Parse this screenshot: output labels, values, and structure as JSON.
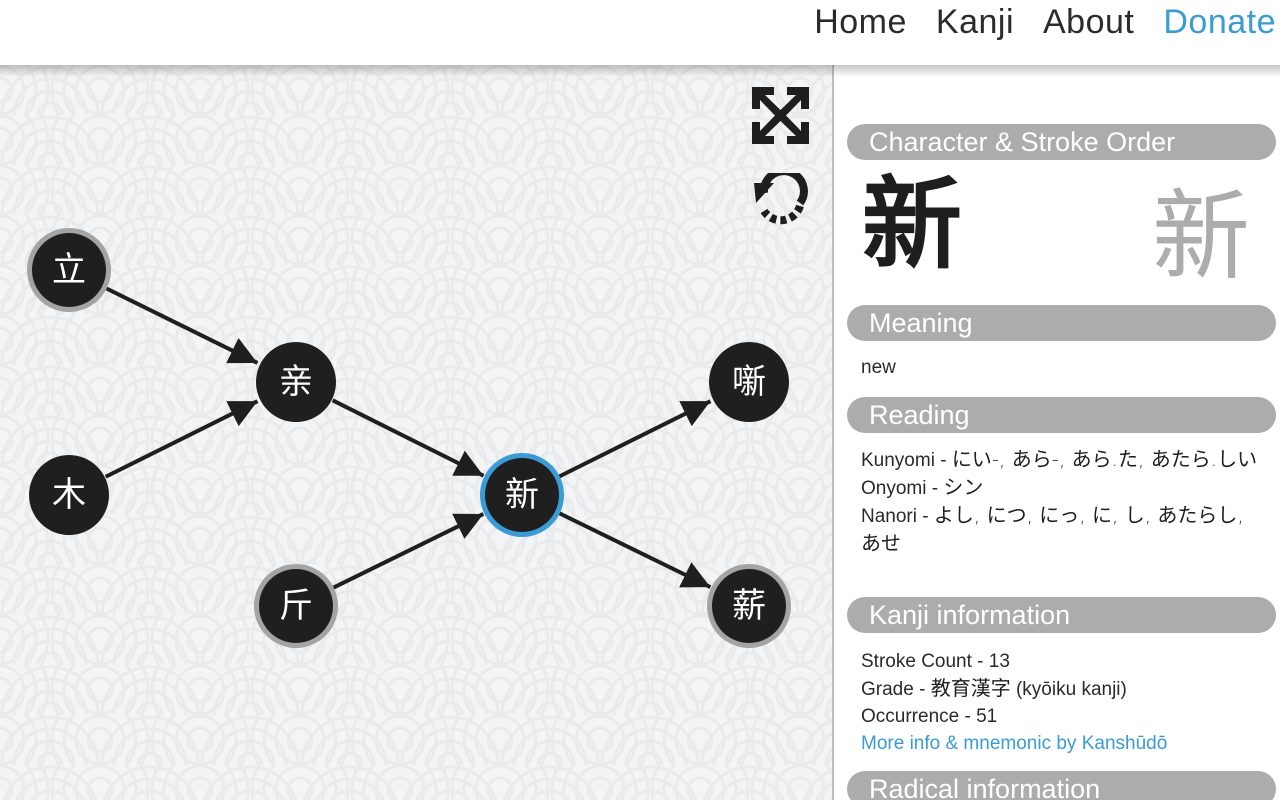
{
  "nav": {
    "items": [
      {
        "label": "Home"
      },
      {
        "label": "Kanji"
      },
      {
        "label": "About"
      },
      {
        "label": "Donate"
      }
    ],
    "accent_color": "#3a9bd5"
  },
  "graph": {
    "tools": {
      "fullscreen_icon": "expand-arrows-icon",
      "reset_icon": "rotate-reset-icon"
    },
    "nodes": [
      {
        "id": "n1",
        "char": "立",
        "ring": "gray"
      },
      {
        "id": "n2",
        "char": "亲",
        "ring": "none"
      },
      {
        "id": "n3",
        "char": "木",
        "ring": "none"
      },
      {
        "id": "n4",
        "char": "新",
        "ring": "blue"
      },
      {
        "id": "n5",
        "char": "斤",
        "ring": "gray"
      },
      {
        "id": "n6",
        "char": "噺",
        "ring": "none"
      },
      {
        "id": "n7",
        "char": "薪",
        "ring": "gray"
      }
    ],
    "edges": [
      {
        "from": "n1",
        "to": "n2"
      },
      {
        "from": "n3",
        "to": "n2"
      },
      {
        "from": "n2",
        "to": "n4"
      },
      {
        "from": "n5",
        "to": "n4"
      },
      {
        "from": "n4",
        "to": "n6"
      },
      {
        "from": "n4",
        "to": "n7"
      }
    ],
    "selected_color": "#3a9bd5"
  },
  "info": {
    "character_header": "Character & Stroke Order",
    "kanji": "新",
    "stroke_order_kanji": "新",
    "meaning_header": "Meaning",
    "meaning": "new",
    "reading_header": "Reading",
    "kunyomi_label": "Kunyomi - ",
    "kunyomi": "にい-, あら-, あら.た, あたら.しい",
    "onyomi_label": "Onyomi - ",
    "onyomi": "シン",
    "nanori_label": "Nanori - ",
    "nanori": "よし, につ, にっ, に, し, あたらし, あせ",
    "kanji_info_header": "Kanji information",
    "stroke_count_label": "Stroke Count - ",
    "stroke_count": "13",
    "grade_label": "Grade - ",
    "grade_jp": "教育漢字",
    "grade_romaji": " (kyōiku kanji)",
    "occurrence_label": "Occurrence - ",
    "occurrence": "51",
    "more_info_link": "More info & mnemonic by Kanshūdō",
    "radical_header": "Radical information"
  }
}
